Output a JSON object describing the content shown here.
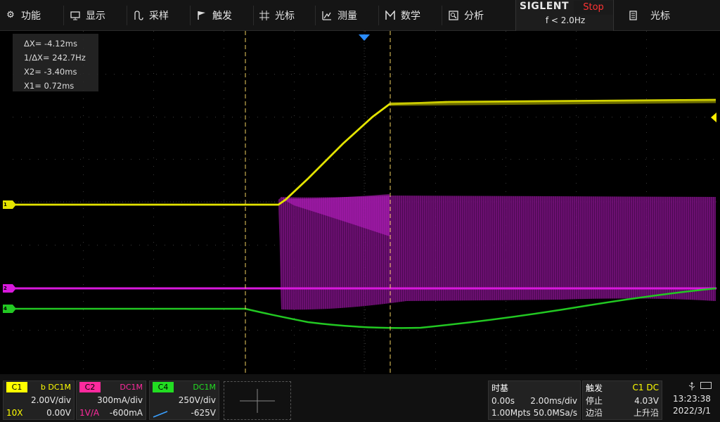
{
  "menu": {
    "items": [
      {
        "label": "功能",
        "icon": "gear-icon"
      },
      {
        "label": "显示",
        "icon": "monitor-icon"
      },
      {
        "label": "采样",
        "icon": "acquire-icon"
      },
      {
        "label": "触发",
        "icon": "flag-icon"
      },
      {
        "label": "光标",
        "icon": "crosshair-icon"
      },
      {
        "label": "测量",
        "icon": "measure-icon"
      },
      {
        "label": "数学",
        "icon": "math-icon"
      },
      {
        "label": "分析",
        "icon": "analyze-icon"
      }
    ],
    "cursor_shortcut": {
      "label": "光标",
      "icon": "document-icon"
    }
  },
  "brand": {
    "logo": "SIGLENT",
    "run_state": "Stop",
    "trigger_frequency": "f < 2.0Hz"
  },
  "cursor_readout": {
    "delta_x": "ΔX= -4.12ms",
    "inv_delta_x": "1/ΔX= 242.7Hz",
    "x2": "X2= -3.40ms",
    "x1": "X1= 0.72ms"
  },
  "markers": {
    "c1": "1",
    "c2": "2",
    "c4": "4"
  },
  "channels": {
    "c1": {
      "tag": "C1",
      "coupling": "b DC1M",
      "scale": "2.00V/div",
      "probe": "10X",
      "offset": "0.00V",
      "color": "#ffff00"
    },
    "c2": {
      "tag": "C2",
      "coupling": "DC1M",
      "scale": "300mA/div",
      "probe": "1V/A",
      "offset": "-600mA",
      "color": "#ff2a9e"
    },
    "c4": {
      "tag": "C4",
      "coupling": "DC1M",
      "scale": "250V/div",
      "probe": "",
      "offset": "-625V",
      "color": "#22dd22"
    }
  },
  "timebase": {
    "title": "时基",
    "delay": "0.00s",
    "scale": "2.00ms/div",
    "memory": "1.00Mpts",
    "sample_rate": "50.0MSa/s"
  },
  "trigger": {
    "title": "触发",
    "source": "C1 DC",
    "mode": "停止",
    "level": "4.03V",
    "type": "边沿",
    "slope": "上升沿"
  },
  "clock": {
    "time": "13:23:38",
    "date": "2022/3/1",
    "usb_icon": "usb-icon"
  },
  "colors": {
    "c1": "#e8e800",
    "c2": "#d01ad8",
    "c4": "#22c822",
    "cursor": "#f0d060",
    "trigger_pos": "#2a8cff"
  }
}
